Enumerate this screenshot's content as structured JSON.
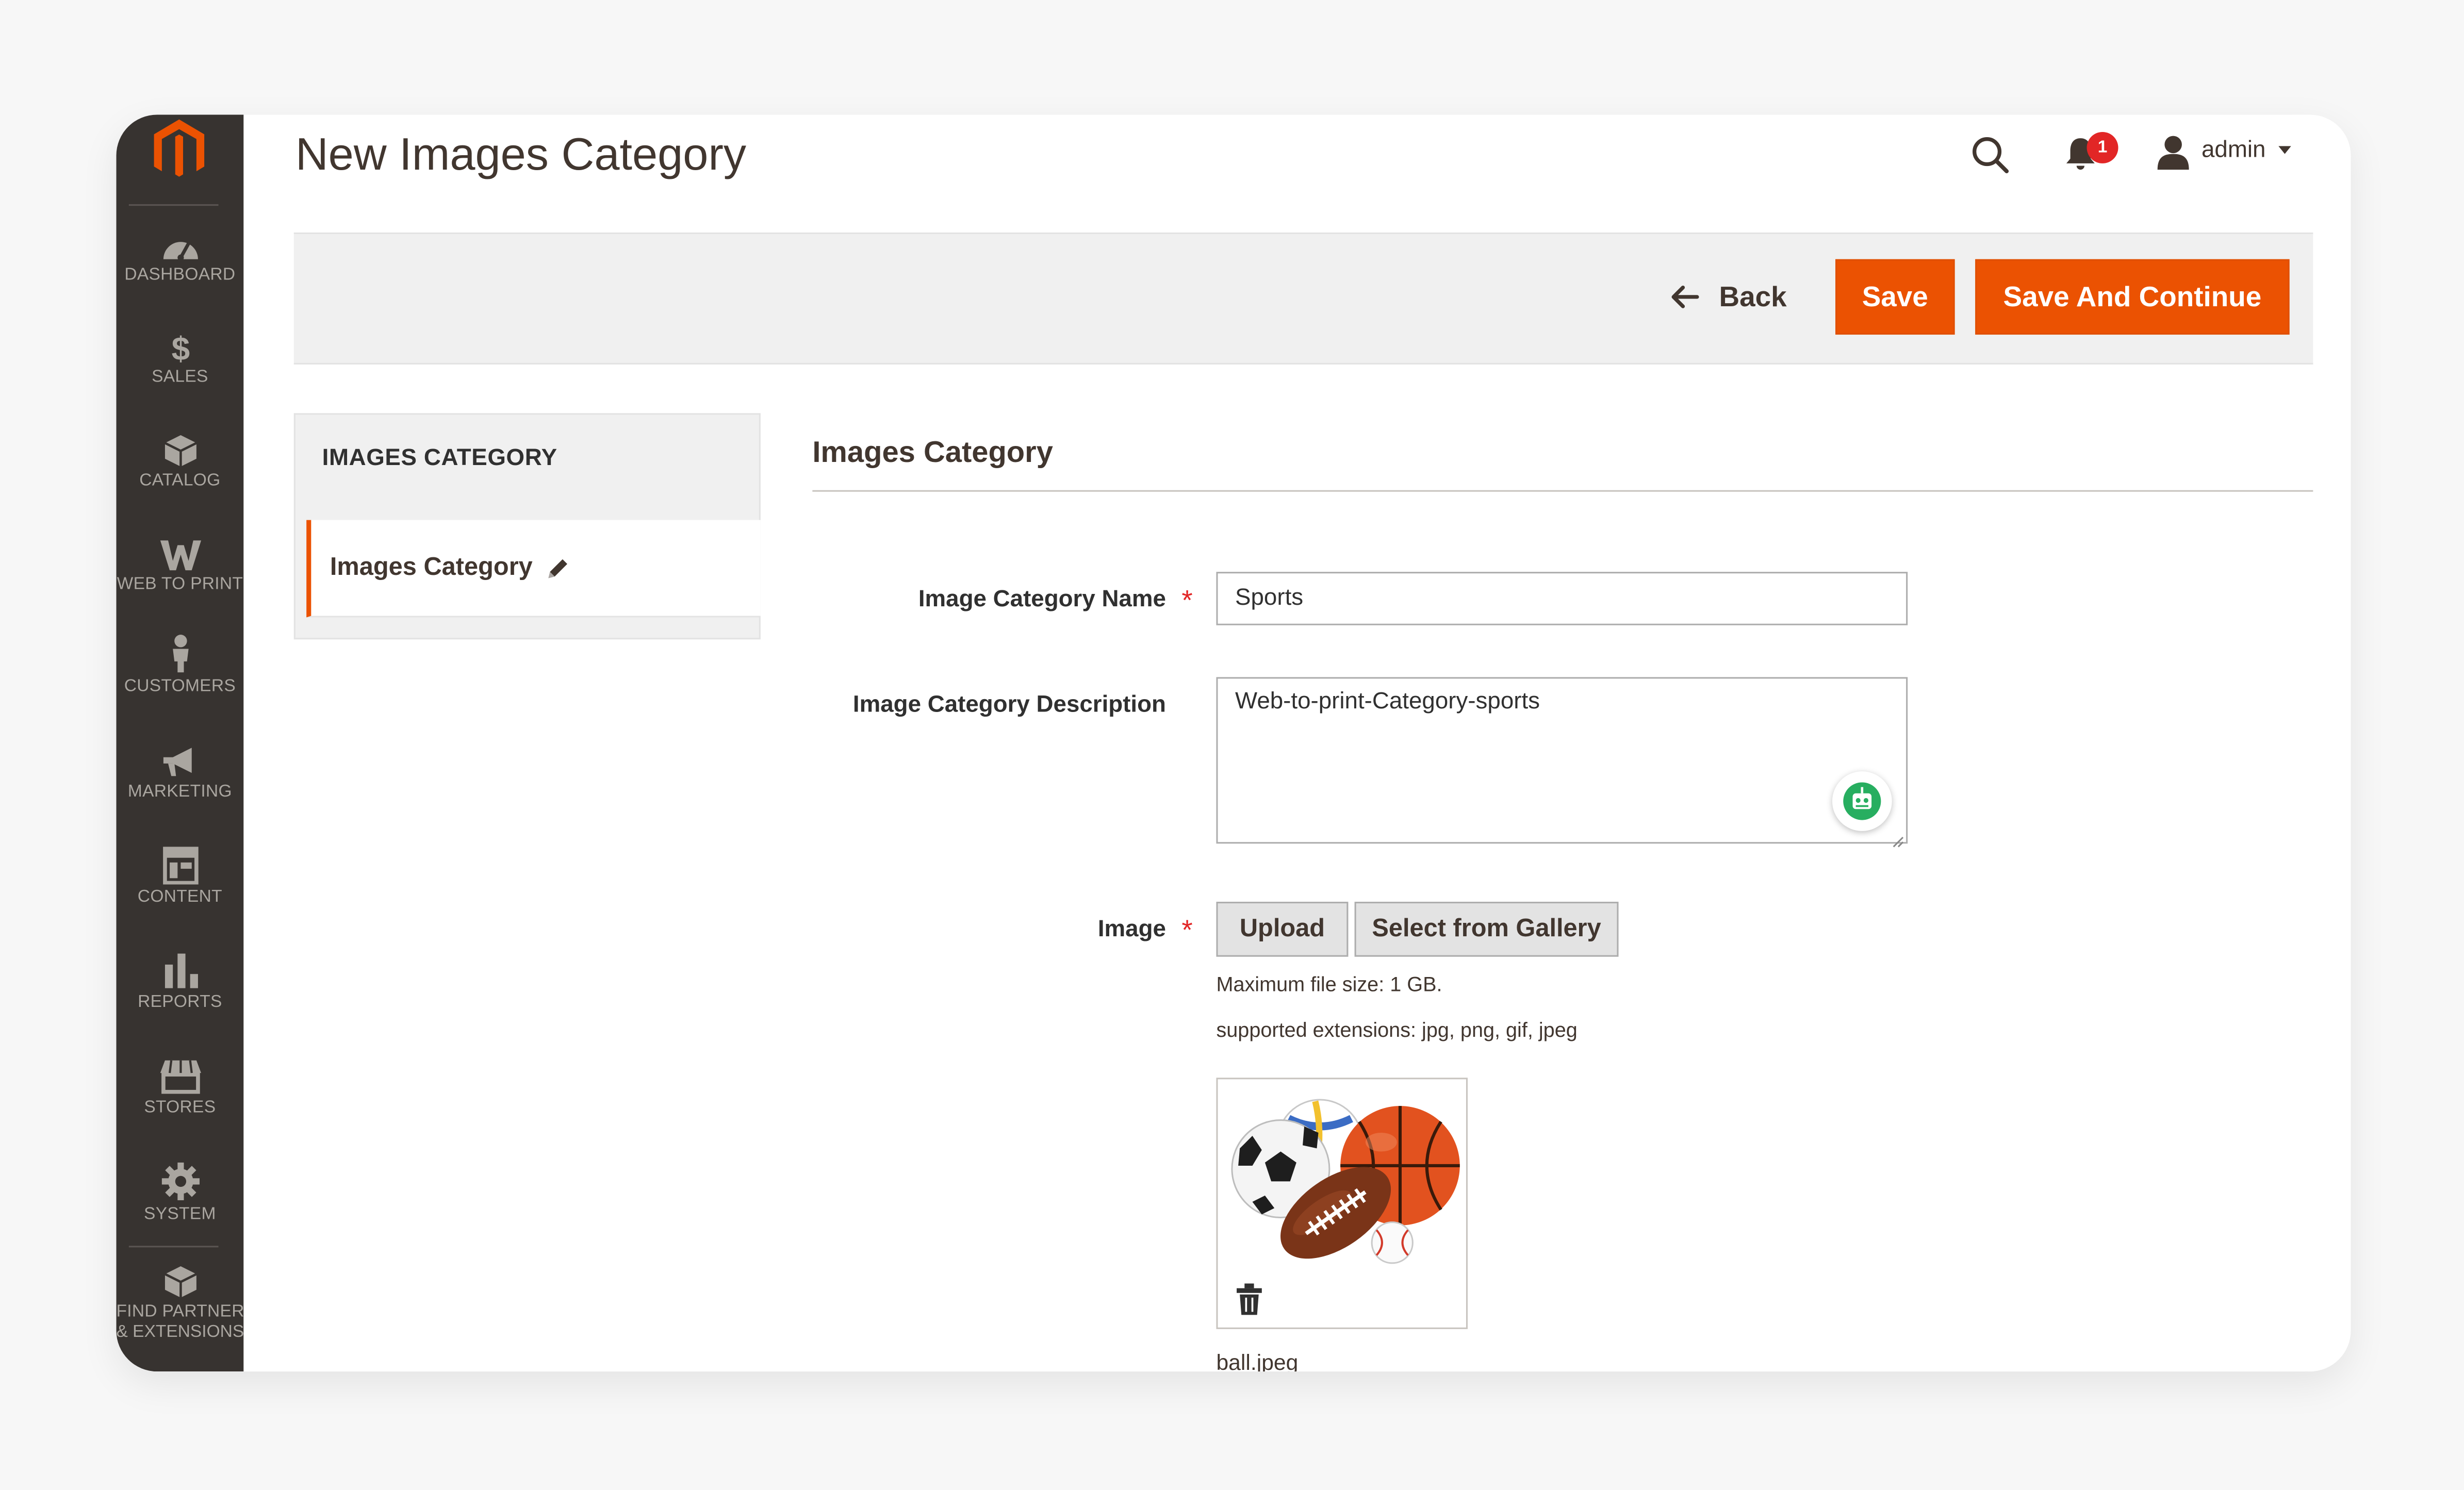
{
  "sidebar": {
    "items": [
      {
        "label": "DASHBOARD",
        "icon": "dashboard-icon"
      },
      {
        "label": "SALES",
        "icon": "dollar-icon"
      },
      {
        "label": "CATALOG",
        "icon": "box-icon"
      },
      {
        "label": "WEB TO PRINT",
        "icon": "w-logo-icon"
      },
      {
        "label": "CUSTOMERS",
        "icon": "person-icon"
      },
      {
        "label": "MARKETING",
        "icon": "megaphone-icon"
      },
      {
        "label": "CONTENT",
        "icon": "layout-icon"
      },
      {
        "label": "REPORTS",
        "icon": "bar-chart-icon"
      },
      {
        "label": "STORES",
        "icon": "store-icon"
      },
      {
        "label": "SYSTEM",
        "icon": "gear-icon"
      }
    ],
    "extensions": {
      "line1": "FIND PARTNERS",
      "line2": "& EXTENSIONS"
    }
  },
  "header": {
    "title": "New Images Category",
    "notifications_count": "1",
    "user": "admin"
  },
  "actions": {
    "back": "Back",
    "save": "Save",
    "save_continue": "Save And Continue"
  },
  "tabs": {
    "title": "IMAGES CATEGORY",
    "item": "Images Category"
  },
  "form": {
    "section_title": "Images Category",
    "name_label": "Image Category Name",
    "name_value": "Sports",
    "description_label": "Image Category Description",
    "description_value": "Web-to-print-Category-sports",
    "image_label": "Image",
    "upload_label": "Upload",
    "gallery_label": "Select from Gallery",
    "max_size_note": "Maximum file size: 1 GB.",
    "extensions_note": "supported extensions: jpg, png, gif, jpeg",
    "filename": "ball.jpeg"
  },
  "colors": {
    "accent": "#eb5202",
    "sidebar": "#373330",
    "required": "#e22626"
  }
}
